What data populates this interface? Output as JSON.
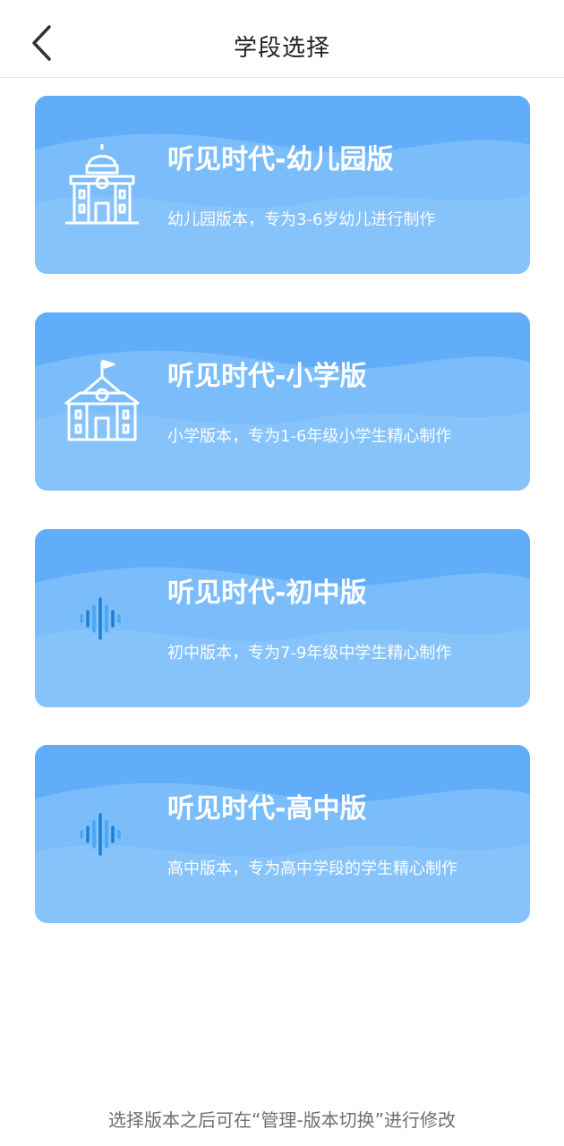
{
  "header": {
    "title": "学段选择",
    "back_icon": "chevron-left-icon"
  },
  "colors": {
    "card_bg": "#7bbdfb",
    "card_wave_dark": "#62adfa",
    "card_wave_light": "#8dc6fb",
    "audio_icon_dark": "#1a7fd6",
    "audio_icon_light": "#4aa6f0"
  },
  "cards": [
    {
      "title": "听见时代-幼儿园版",
      "desc": "幼儿园版本，专为3-6岁幼儿进行制作",
      "icon": "kindergarten-building-icon"
    },
    {
      "title": "听见时代-小学版",
      "desc": "小学版本，专为1-6年级小学生精心制作",
      "icon": "school-building-icon"
    },
    {
      "title": "听见时代-初中版",
      "desc": "初中版本，专为7-9年级中学生精心制作",
      "icon": "audio-wave-icon"
    },
    {
      "title": "听见时代-高中版",
      "desc": "高中版本，专为高中学段的学生精心制作",
      "icon": "audio-wave-icon"
    }
  ],
  "footer": {
    "note": "选择版本之后可在“管理-版本切换”进行修改"
  }
}
